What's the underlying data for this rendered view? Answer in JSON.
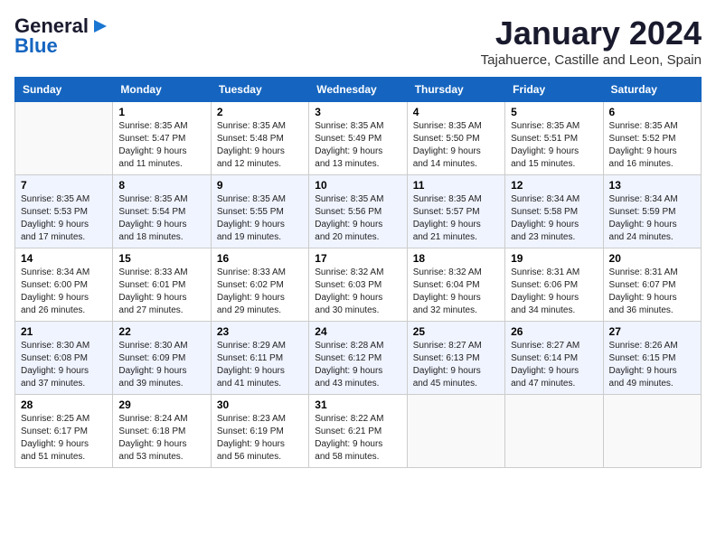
{
  "logo": {
    "text_general": "General",
    "text_blue": "Blue"
  },
  "title": "January 2024",
  "subtitle": "Tajahuerce, Castille and Leon, Spain",
  "headers": [
    "Sunday",
    "Monday",
    "Tuesday",
    "Wednesday",
    "Thursday",
    "Friday",
    "Saturday"
  ],
  "weeks": [
    [
      {
        "day": "",
        "info": ""
      },
      {
        "day": "1",
        "info": "Sunrise: 8:35 AM\nSunset: 5:47 PM\nDaylight: 9 hours\nand 11 minutes."
      },
      {
        "day": "2",
        "info": "Sunrise: 8:35 AM\nSunset: 5:48 PM\nDaylight: 9 hours\nand 12 minutes."
      },
      {
        "day": "3",
        "info": "Sunrise: 8:35 AM\nSunset: 5:49 PM\nDaylight: 9 hours\nand 13 minutes."
      },
      {
        "day": "4",
        "info": "Sunrise: 8:35 AM\nSunset: 5:50 PM\nDaylight: 9 hours\nand 14 minutes."
      },
      {
        "day": "5",
        "info": "Sunrise: 8:35 AM\nSunset: 5:51 PM\nDaylight: 9 hours\nand 15 minutes."
      },
      {
        "day": "6",
        "info": "Sunrise: 8:35 AM\nSunset: 5:52 PM\nDaylight: 9 hours\nand 16 minutes."
      }
    ],
    [
      {
        "day": "7",
        "info": "Sunrise: 8:35 AM\nSunset: 5:53 PM\nDaylight: 9 hours\nand 17 minutes."
      },
      {
        "day": "8",
        "info": "Sunrise: 8:35 AM\nSunset: 5:54 PM\nDaylight: 9 hours\nand 18 minutes."
      },
      {
        "day": "9",
        "info": "Sunrise: 8:35 AM\nSunset: 5:55 PM\nDaylight: 9 hours\nand 19 minutes."
      },
      {
        "day": "10",
        "info": "Sunrise: 8:35 AM\nSunset: 5:56 PM\nDaylight: 9 hours\nand 20 minutes."
      },
      {
        "day": "11",
        "info": "Sunrise: 8:35 AM\nSunset: 5:57 PM\nDaylight: 9 hours\nand 21 minutes."
      },
      {
        "day": "12",
        "info": "Sunrise: 8:34 AM\nSunset: 5:58 PM\nDaylight: 9 hours\nand 23 minutes."
      },
      {
        "day": "13",
        "info": "Sunrise: 8:34 AM\nSunset: 5:59 PM\nDaylight: 9 hours\nand 24 minutes."
      }
    ],
    [
      {
        "day": "14",
        "info": "Sunrise: 8:34 AM\nSunset: 6:00 PM\nDaylight: 9 hours\nand 26 minutes."
      },
      {
        "day": "15",
        "info": "Sunrise: 8:33 AM\nSunset: 6:01 PM\nDaylight: 9 hours\nand 27 minutes."
      },
      {
        "day": "16",
        "info": "Sunrise: 8:33 AM\nSunset: 6:02 PM\nDaylight: 9 hours\nand 29 minutes."
      },
      {
        "day": "17",
        "info": "Sunrise: 8:32 AM\nSunset: 6:03 PM\nDaylight: 9 hours\nand 30 minutes."
      },
      {
        "day": "18",
        "info": "Sunrise: 8:32 AM\nSunset: 6:04 PM\nDaylight: 9 hours\nand 32 minutes."
      },
      {
        "day": "19",
        "info": "Sunrise: 8:31 AM\nSunset: 6:06 PM\nDaylight: 9 hours\nand 34 minutes."
      },
      {
        "day": "20",
        "info": "Sunrise: 8:31 AM\nSunset: 6:07 PM\nDaylight: 9 hours\nand 36 minutes."
      }
    ],
    [
      {
        "day": "21",
        "info": "Sunrise: 8:30 AM\nSunset: 6:08 PM\nDaylight: 9 hours\nand 37 minutes."
      },
      {
        "day": "22",
        "info": "Sunrise: 8:30 AM\nSunset: 6:09 PM\nDaylight: 9 hours\nand 39 minutes."
      },
      {
        "day": "23",
        "info": "Sunrise: 8:29 AM\nSunset: 6:11 PM\nDaylight: 9 hours\nand 41 minutes."
      },
      {
        "day": "24",
        "info": "Sunrise: 8:28 AM\nSunset: 6:12 PM\nDaylight: 9 hours\nand 43 minutes."
      },
      {
        "day": "25",
        "info": "Sunrise: 8:27 AM\nSunset: 6:13 PM\nDaylight: 9 hours\nand 45 minutes."
      },
      {
        "day": "26",
        "info": "Sunrise: 8:27 AM\nSunset: 6:14 PM\nDaylight: 9 hours\nand 47 minutes."
      },
      {
        "day": "27",
        "info": "Sunrise: 8:26 AM\nSunset: 6:15 PM\nDaylight: 9 hours\nand 49 minutes."
      }
    ],
    [
      {
        "day": "28",
        "info": "Sunrise: 8:25 AM\nSunset: 6:17 PM\nDaylight: 9 hours\nand 51 minutes."
      },
      {
        "day": "29",
        "info": "Sunrise: 8:24 AM\nSunset: 6:18 PM\nDaylight: 9 hours\nand 53 minutes."
      },
      {
        "day": "30",
        "info": "Sunrise: 8:23 AM\nSunset: 6:19 PM\nDaylight: 9 hours\nand 56 minutes."
      },
      {
        "day": "31",
        "info": "Sunrise: 8:22 AM\nSunset: 6:21 PM\nDaylight: 9 hours\nand 58 minutes."
      },
      {
        "day": "",
        "info": ""
      },
      {
        "day": "",
        "info": ""
      },
      {
        "day": "",
        "info": ""
      }
    ]
  ]
}
